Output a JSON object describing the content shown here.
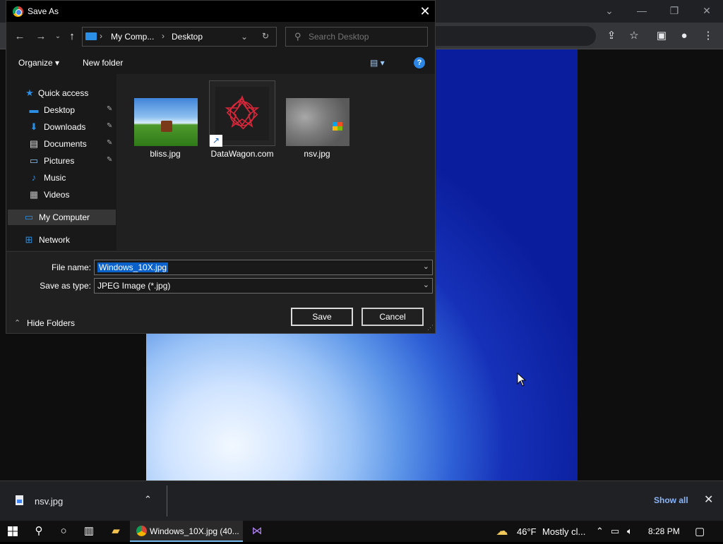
{
  "dialog": {
    "title": "Save As",
    "close_glyph": "✕",
    "address": {
      "crumb1": "My Comp...",
      "crumb2": "Desktop",
      "separator": "›"
    },
    "search_placeholder": "Search Desktop",
    "toolbar": {
      "organize": "Organize ▾",
      "new_folder": "New folder",
      "view_glyph": "▤ ▾",
      "help_glyph": "?"
    },
    "nav": {
      "quick_access": "Quick access",
      "items": [
        {
          "label": "Desktop",
          "icon": "desktop-icon"
        },
        {
          "label": "Downloads",
          "icon": "download-icon"
        },
        {
          "label": "Documents",
          "icon": "documents-icon"
        },
        {
          "label": "Pictures",
          "icon": "pictures-icon"
        },
        {
          "label": "Music",
          "icon": "music-icon"
        },
        {
          "label": "Videos",
          "icon": "videos-icon"
        }
      ],
      "my_computer": "My Computer",
      "network": "Network"
    },
    "files": [
      {
        "name": "bliss.jpg"
      },
      {
        "name": "DataWagon.com"
      },
      {
        "name": "nsv.jpg"
      }
    ],
    "file_name_label": "File name:",
    "file_name_value": "Windows_10X.jpg",
    "save_type_label": "Save as type:",
    "save_type_value": "JPEG Image (*.jpg)",
    "hide_folders": "Hide Folders",
    "save_button": "Save",
    "cancel_button": "Cancel"
  },
  "download_bar": {
    "file_name": "nsv.jpg",
    "show_all": "Show all",
    "close_glyph": "✕"
  },
  "taskbar": {
    "chrome_task_label": "Windows_10X.jpg (40...",
    "weather_temp": "46°F",
    "weather_desc": "Mostly cl...",
    "time": "8:28 PM"
  }
}
